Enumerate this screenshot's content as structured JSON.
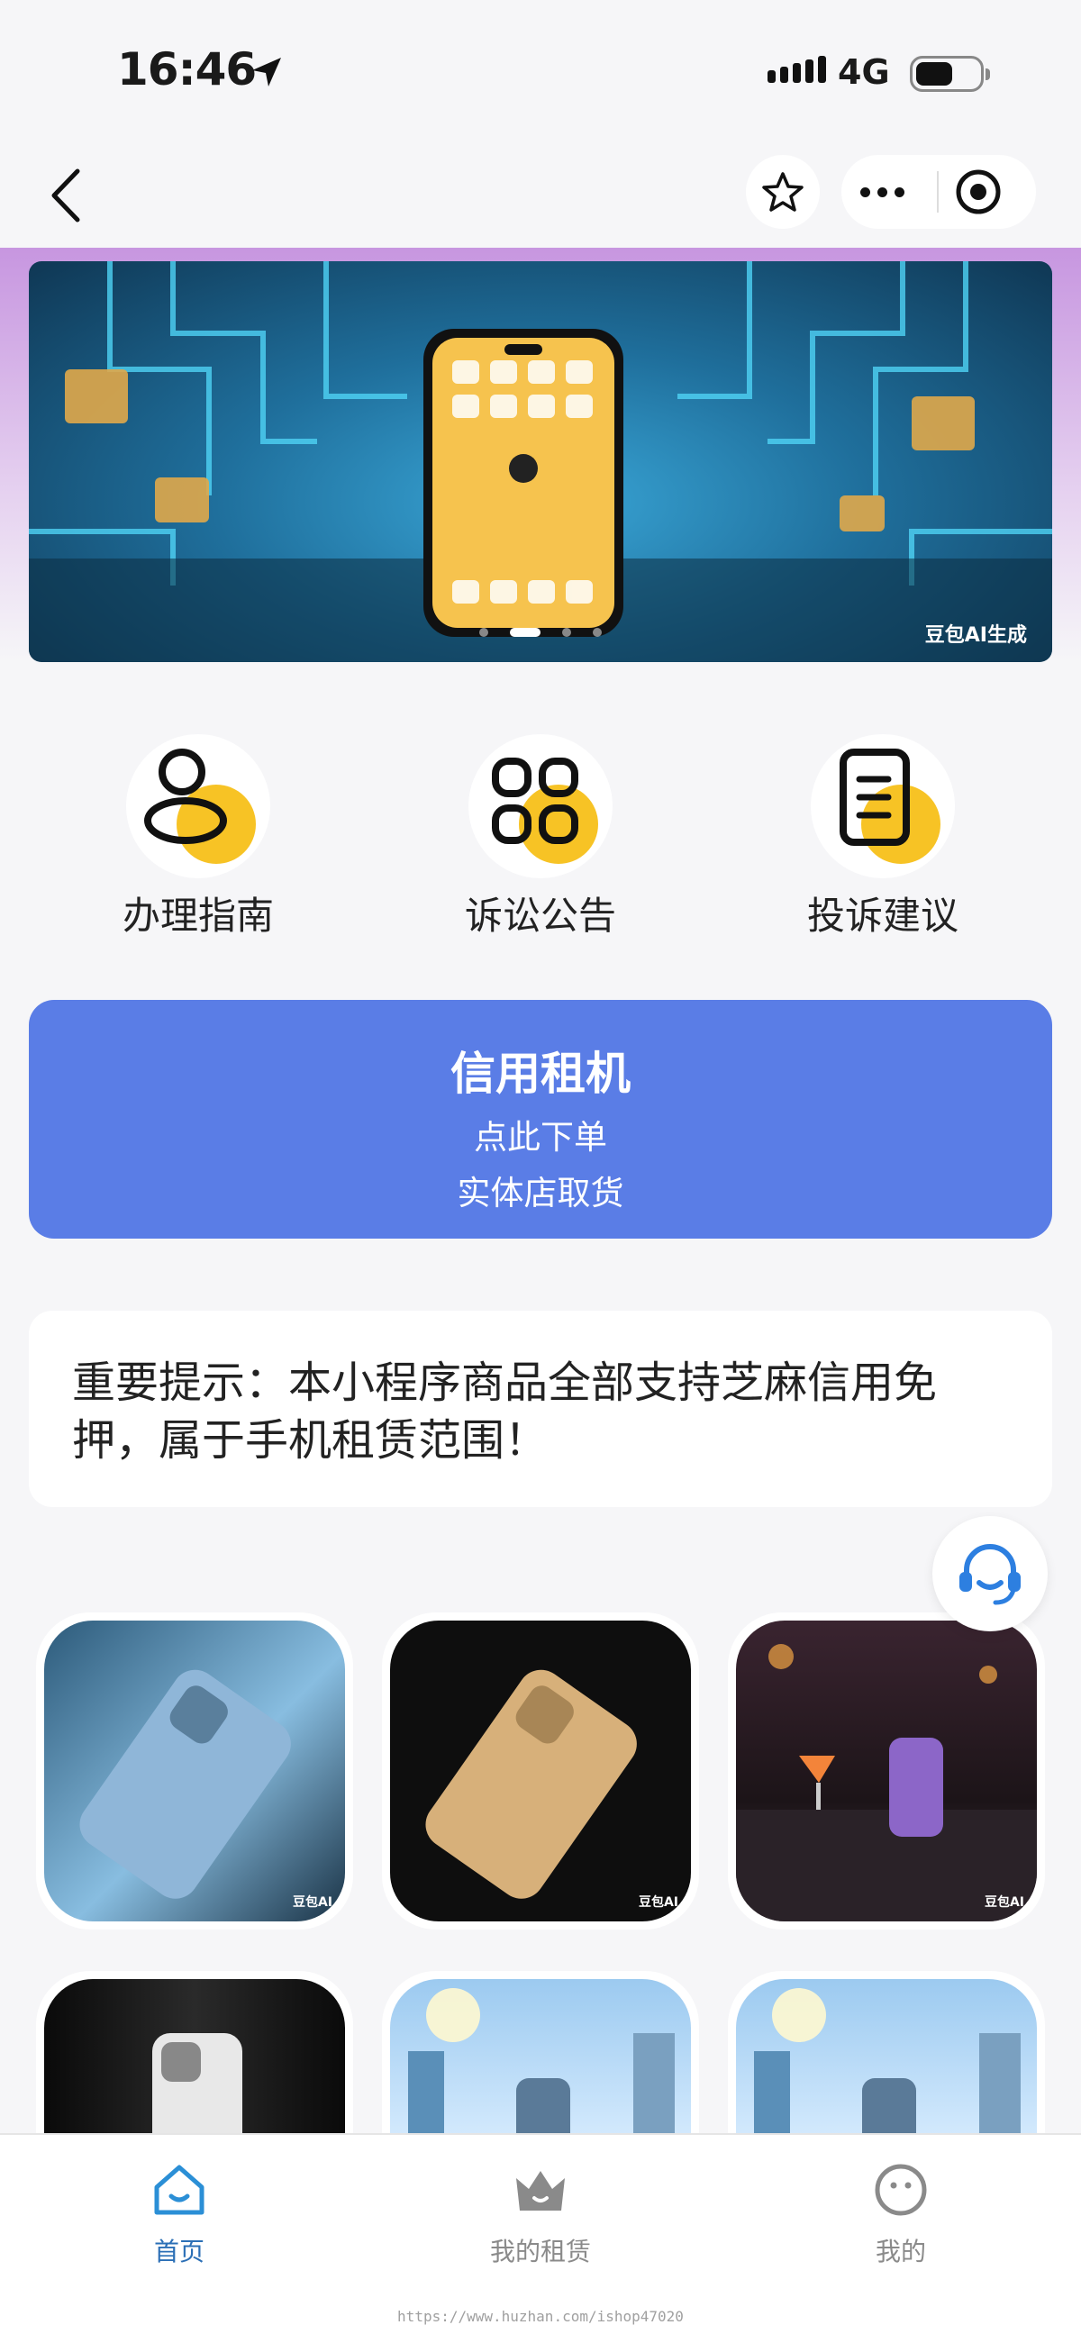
{
  "status": {
    "time": "16:46",
    "network": "4G"
  },
  "header": {
    "back_icon": "chevron-left-icon",
    "favorite_icon": "star-icon",
    "more_icon": "more-dots-icon",
    "close_icon": "record-circle-icon"
  },
  "banner": {
    "watermark": "豆包AI生成",
    "slides_count": 4,
    "active_slide": 2
  },
  "quick_nav": [
    {
      "label": "办理指南",
      "icon": "person-guide-icon"
    },
    {
      "label": "诉讼公告",
      "icon": "grid-apps-icon"
    },
    {
      "label": "投诉建议",
      "icon": "document-icon"
    }
  ],
  "cta": {
    "title": "信用租机",
    "line1": "点此下单",
    "line2": "实体店取货"
  },
  "notice": {
    "text": "重要提示：本小程序商品全部支持芝麻信用免押，属于手机租赁范围！"
  },
  "service_icon": "customer-service-icon",
  "products": [
    {
      "tag": "豆包AI"
    },
    {
      "tag": "豆包AI"
    },
    {
      "tag": "豆包AI"
    },
    {
      "tag": ""
    },
    {
      "tag": ""
    },
    {
      "tag": ""
    }
  ],
  "tabbar": [
    {
      "label": "首页",
      "icon": "home-icon",
      "active": true
    },
    {
      "label": "我的租赁",
      "icon": "crown-icon",
      "active": false
    },
    {
      "label": "我的",
      "icon": "smiley-icon",
      "active": false
    }
  ],
  "footer": {
    "url": "https://www.huzhan.com/ishop47020"
  },
  "colors": {
    "accent": "#5a7de6",
    "icon_yellow": "#f7c325",
    "tab_active": "#2b6fb6"
  }
}
